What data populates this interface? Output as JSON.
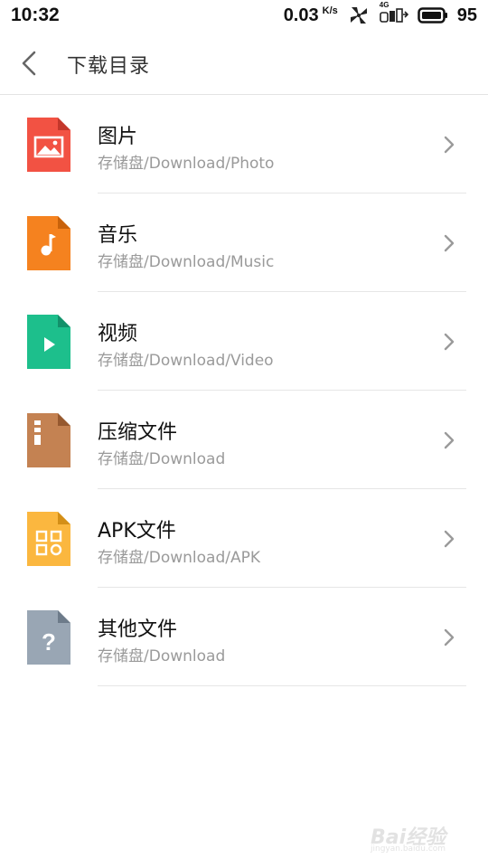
{
  "status_bar": {
    "time": "10:32",
    "speed": "0.03",
    "speed_unit": "K/s",
    "network_label": "4G",
    "battery": "95",
    "icons": [
      "pinwheel-icon",
      "signal-icon",
      "battery-icon"
    ]
  },
  "header": {
    "title": "下载目录",
    "back_icon": "chevron-left-icon"
  },
  "items": [
    {
      "title": "图片",
      "path": "存储盘/Download/Photo",
      "icon": "image-file-icon",
      "color": "#F25243"
    },
    {
      "title": "音乐",
      "path": "存储盘/Download/Music",
      "icon": "music-file-icon",
      "color": "#F5821F"
    },
    {
      "title": "视频",
      "path": "存储盘/Download/Video",
      "icon": "video-file-icon",
      "color": "#1DBF8C"
    },
    {
      "title": "压缩文件",
      "path": "存储盘/Download",
      "icon": "archive-file-icon",
      "color": "#C48252"
    },
    {
      "title": "APK文件",
      "path": "存储盘/Download/APK",
      "icon": "apk-file-icon",
      "color": "#FBB73F"
    },
    {
      "title": "其他文件",
      "path": "存储盘/Download",
      "icon": "unknown-file-icon",
      "color": "#99A6B4"
    }
  ],
  "watermark": {
    "text": "Bai经验",
    "sub": "jingyan.baidu.com"
  }
}
